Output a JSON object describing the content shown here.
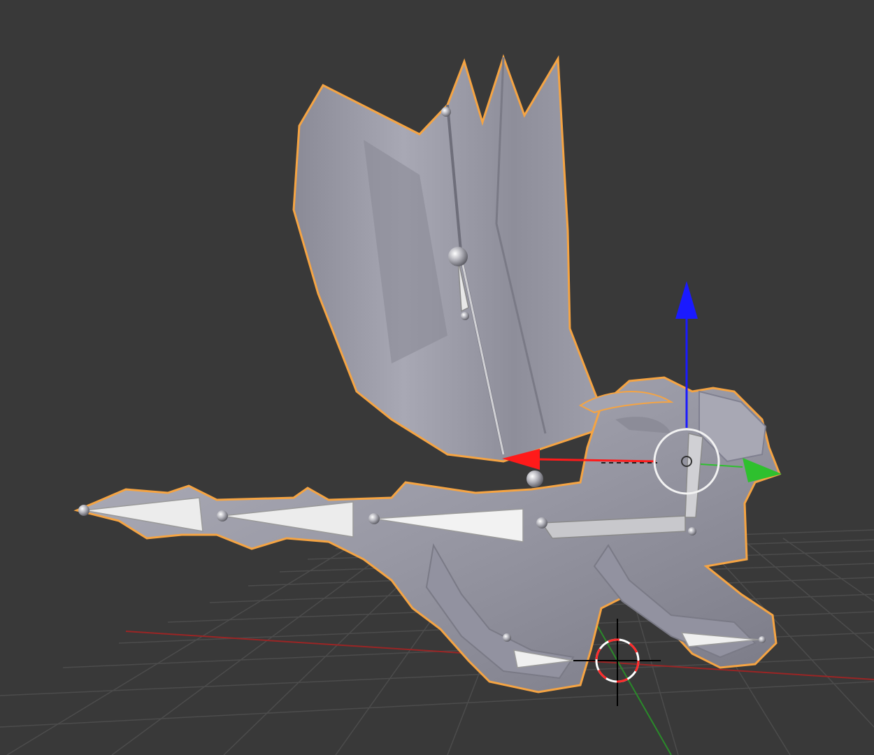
{
  "app": {
    "title": ""
  },
  "viewport": {
    "background": "#393939",
    "view": "perspective",
    "shading": "solid",
    "grid_floor": true
  },
  "scene_objects": [
    {
      "name": "dragon",
      "kind": "mesh",
      "selected": true,
      "outline": "#f5a443",
      "material": "#9c9ca8"
    },
    {
      "name": "armature",
      "kind": "armature",
      "bones": [
        "tail",
        "spine",
        "wing",
        "neck",
        "legs"
      ],
      "bone_color": "#e8e8e8"
    }
  ],
  "gizmo": {
    "mode": "translate",
    "axes": {
      "x": "#ff1a1a",
      "y": "#2ec02e",
      "z": "#1a1aff"
    },
    "ring": "#f2f2f2"
  },
  "axis_lines": {
    "x": "#9a2525",
    "y": "#2a8a2a"
  },
  "cursor_3d": {
    "ring_colors": [
      "#ff2a2a",
      "#ffffff"
    ],
    "crosshair": "#000000"
  }
}
